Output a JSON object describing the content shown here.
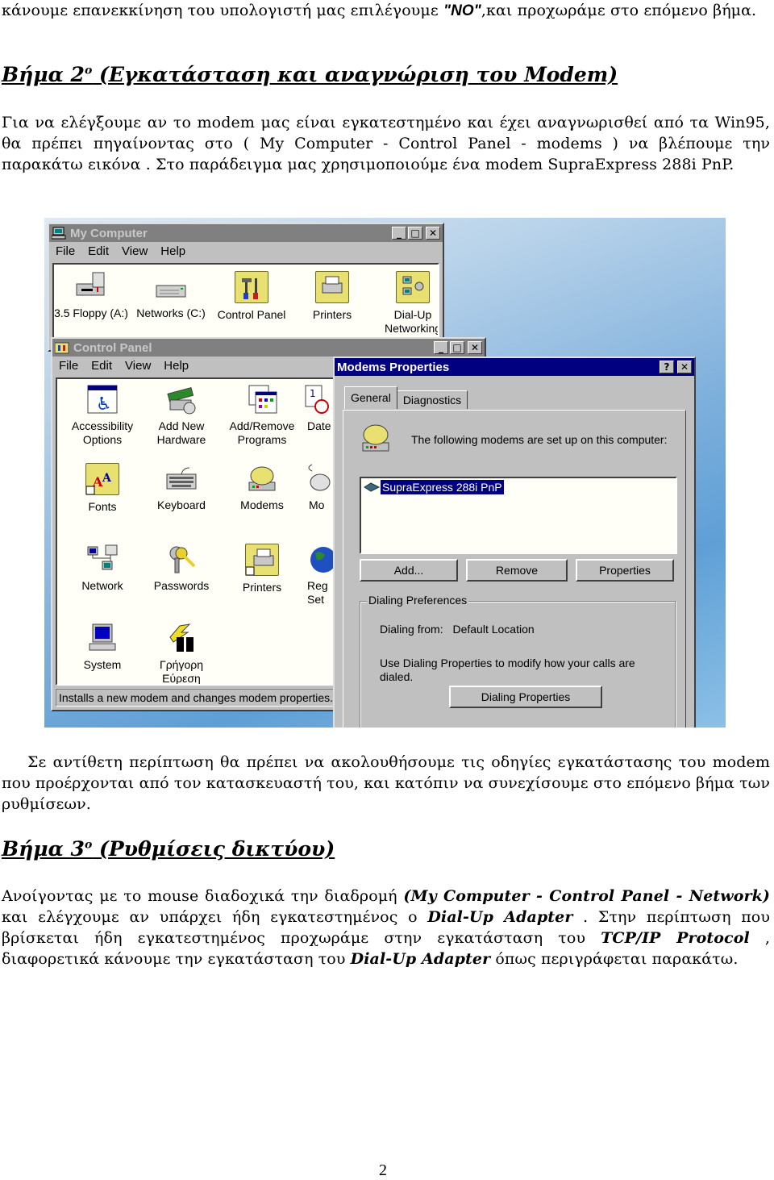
{
  "document": {
    "intro_line1_pre": "κάνουμε επανεκκίνηση του υπολογιστή μας επιλέγουμε ",
    "intro_line1_bold": "\"NO\"",
    "intro_line1_post": ",και προχωράμε στο επόμενο βήμα.",
    "step2_heading_pre": "Βήμα 2",
    "step2_heading_sup": "ο",
    "step2_heading_post": " (Εγκατάσταση και αναγνώριση του Modem)",
    "step2_paragraph": "Για να ελέγξουμε αν το modem μας είναι εγκατεστημένο και έχει αναγνωρισθεί από τα Win95, θα πρέπει πηγαίνοντας στο ( My Computer - Control Panel - modems ) να βλέπουμε την παρακάτω εικόνα . Στο παράδειγμα μας χρησιμοποιούμε ένα modem SupraExpress 288i PnP.",
    "after_image_paragraph": "Σε αντίθετη περίπτωση θα πρέπει να ακολουθήσουμε τις οδηγίες εγκατάστασης του modem που προέρχονται από τον κατασκευαστή του, και κατόπιν να συνεχίσουμε στο επόμενο βήμα των ρυθμίσεων.",
    "step3_heading_pre": "Βήμα 3",
    "step3_heading_sup": "ο",
    "step3_heading_post": " (Ρυθμίσεις δικτύου)",
    "step3_p_1": "Ανοίγοντας με το mouse διαδοχικά την διαδρομή ",
    "step3_p_b1": "(My Computer - Control Panel - Network)",
    "step3_p_2": " και ελέγχουμε αν υπάρχει ήδη εγκατεστημένος ο ",
    "step3_p_b2": "Dial-Up Adapter",
    "step3_p_3": " . Στην περίπτωση που βρίσκεται ήδη εγκατεστημένος προχωράμε στην εγκατάσταση του ",
    "step3_p_b3": "TCP/IP Protocol",
    "step3_p_4": " , διαφορετικά κάνουμε την εγκατάσταση του ",
    "step3_p_b4": "Dial-Up Adapter",
    "step3_p_5": " όπως περιγράφεται παρακάτω.",
    "page_number": "2"
  },
  "my_computer": {
    "title": "My Computer",
    "menu": [
      "File",
      "Edit",
      "View",
      "Help"
    ],
    "items": [
      {
        "label": "3.5 Floppy (A:)",
        "icon": "floppy-drive-icon"
      },
      {
        "label": "Networks (C:)",
        "icon": "hard-drive-icon"
      },
      {
        "label": "Control Panel",
        "icon": "control-panel-folder-icon"
      },
      {
        "label": "Printers",
        "icon": "printers-folder-icon"
      },
      {
        "label": "Dial-Up Networking",
        "icon": "dialup-folder-icon"
      }
    ]
  },
  "control_panel": {
    "title": "Control Panel",
    "menu": [
      "File",
      "Edit",
      "View",
      "Help"
    ],
    "items": [
      {
        "label": "Accessibility Options"
      },
      {
        "label": "Add New Hardware"
      },
      {
        "label": "Add/Remove Programs"
      },
      {
        "label": "Date"
      },
      {
        "label": "Fonts"
      },
      {
        "label": "Keyboard"
      },
      {
        "label": "Modems"
      },
      {
        "label": "Mo"
      },
      {
        "label": "Network"
      },
      {
        "label": "Passwords"
      },
      {
        "label": "Printers"
      },
      {
        "label": "Reg Set"
      },
      {
        "label": "System"
      },
      {
        "label": "Γρήγορη Εύρεση"
      }
    ],
    "status": "Installs a new modem and changes modem properties."
  },
  "modems_properties": {
    "title": "Modems Properties",
    "tabs": [
      "General",
      "Diagnostics"
    ],
    "intro": "The following modems are set up on this computer:",
    "modems": [
      "SupraExpress 288i PnP"
    ],
    "buttons": {
      "add": "Add...",
      "remove": "Remove",
      "properties": "Properties"
    },
    "dialing": {
      "group_label": "Dialing Preferences",
      "from_label": "Dialing from:",
      "from_value": "Default Location",
      "hint": "Use Dialing Properties to modify how your calls are dialed.",
      "button": "Dialing Properties"
    }
  }
}
